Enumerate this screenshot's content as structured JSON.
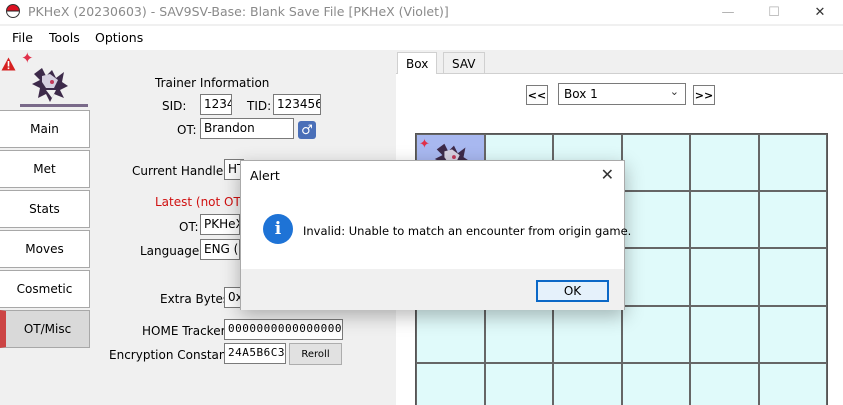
{
  "window": {
    "title": "PKHeX (20230603) - SAV9SV-Base: Blank Save File [PKHeX (Violet)]",
    "minimize_icon": "minimize-icon",
    "maximize_icon": "maximize-icon",
    "close_icon": "close-icon"
  },
  "menu": {
    "items": [
      "File",
      "Tools",
      "Options"
    ]
  },
  "sidebar": {
    "items": [
      {
        "label": "Main"
      },
      {
        "label": "Met"
      },
      {
        "label": "Stats"
      },
      {
        "label": "Moves"
      },
      {
        "label": "Cosmetic"
      },
      {
        "label": "OT/Misc",
        "active": true
      }
    ]
  },
  "trainer": {
    "heading": "Trainer Information",
    "sid_label": "SID:",
    "sid_value": "1234",
    "tid_label": "TID:",
    "tid_value": "123456",
    "ot_label": "OT:",
    "ot_value": "Brandon",
    "gender_symbol": "♂"
  },
  "handler": {
    "current_label": "Current Handler:",
    "current_value": "HT",
    "latest_label": "Latest (not OT) H",
    "ot_label": "OT:",
    "ot_value": "PKHeX",
    "language_label": "Language:",
    "language_value": "ENG (E"
  },
  "misc": {
    "extra_bytes_label": "Extra Bytes:",
    "extra_bytes_value": "0x",
    "home_tracker_label": "HOME Tracker:",
    "home_tracker_value": "0000000000000000",
    "encryption_label": "Encryption Constant:",
    "encryption_value": "24A5B6C3",
    "reroll_label": "Reroll"
  },
  "box": {
    "tabs": [
      "Box",
      "SAV"
    ],
    "prev_label": "<<",
    "next_label": ">>",
    "selected_box": "Box 1",
    "rows": 5,
    "cols": 6
  },
  "alert": {
    "title": "Alert",
    "message": "Invalid: Unable to match an encounter from origin game.",
    "ok_label": "OK",
    "info_glyph": "i"
  },
  "colors": {
    "active_tab_accent": "#cc4444",
    "slot_empty": "#e0fafa",
    "slot_filled": "#a8b8f0",
    "latest_handler_text": "#d01010",
    "info_icon": "#1e73d6"
  }
}
